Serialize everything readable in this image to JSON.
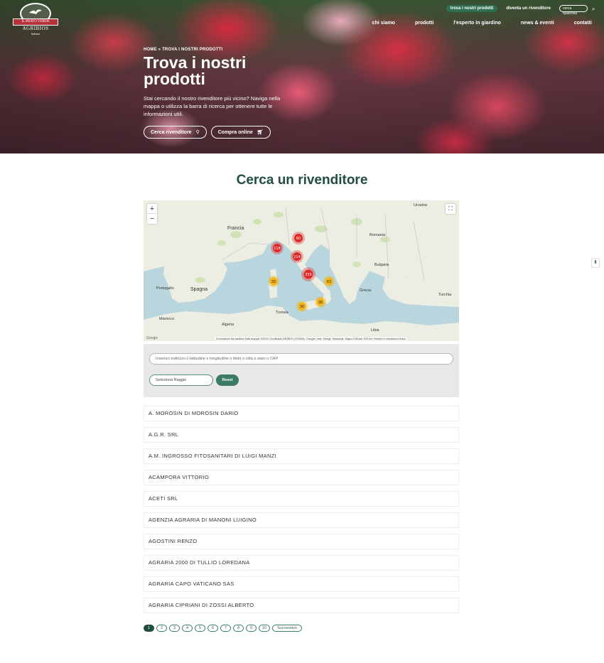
{
  "logo": {
    "ribbon": "IL PRATO VERDE",
    "brand": "AGRIBIOS",
    "sub": "Italiana"
  },
  "topbar": {
    "find_products": "trova i nostri prodotti",
    "become_reseller": "diventa un rivenditore",
    "search_placeholder": "cerca qualcosa"
  },
  "nav": {
    "items": [
      "chi siamo",
      "prodotti",
      "l'esperto in giardino",
      "news & eventi",
      "contatti"
    ]
  },
  "hero": {
    "breadcrumb": "HOME » TROVA I NOSTRI PRODOTTI",
    "title": "Trova i nostri prodotti",
    "description": "Stai cercando il nostro rivenditore più vicino? Naviga nella mappa o utilizza la barra di ricerca per ottenere tutte le informazioni utili.",
    "cta_reseller": "Cerca rivenditore",
    "cta_shop": "Compra online"
  },
  "section": {
    "title": "Cerca un rivenditore"
  },
  "map": {
    "labels": {
      "ucraina": "Ucraina",
      "francia": "Francia",
      "romania": "Romania",
      "bulgaria": "Bulgaria",
      "spagna": "Spagna",
      "portogallo": "Portogallo",
      "turchia": "Turchia",
      "grecia": "Grecia",
      "algeria": "Algeria",
      "tunisia": "Tunisia",
      "libia": "Libia",
      "marocco": "Marocco"
    },
    "clusters": [
      "60",
      "118",
      "214",
      "335",
      "35",
      "63",
      "36",
      "36"
    ],
    "attribution": "Scorciatoie da tastiera   Dati mappa ©2021 GeoBasis-DE/BKG (©2009), Google, Inst. Geogr. Nacional, Mapa GISrael   200 km   Termini e condizioni d'uso",
    "google": "Google"
  },
  "form": {
    "search_placeholder": "Inserisci indirizzo o latitudine e longitudine o titolo o città o stato o CAP",
    "radius_label": "Seleziona Raggio",
    "reset_label": "Reset"
  },
  "resellers": [
    "A. MOROSIN DI MOROSIN DARIO",
    "A.G.R. SRL",
    "A.M. INGROSSO FITOSANITARI DI LUIGI MANZI",
    "ACAMPORA VITTORIO",
    "ACETI SRL",
    "AGENZIA AGRARIA DI MANONI LUIGINO",
    "AGOSTINI RENZO",
    "AGRARIA 2000 DI TULLIO LOREDANA",
    "AGRARIA CAPO VATICANO SAS",
    "AGRARIA CIPRIANI DI ZOSSI ALBERTO"
  ],
  "pagination": {
    "pages": [
      "1",
      "2",
      "3",
      "4",
      "5",
      "6",
      "7",
      "8",
      "9",
      "10"
    ],
    "next": "Successivo"
  },
  "colors": {
    "brand_green": "#1f4e3a",
    "accent_green": "#3d7a68",
    "cluster_red": "#e02828",
    "cluster_yellow": "#f2b417"
  }
}
